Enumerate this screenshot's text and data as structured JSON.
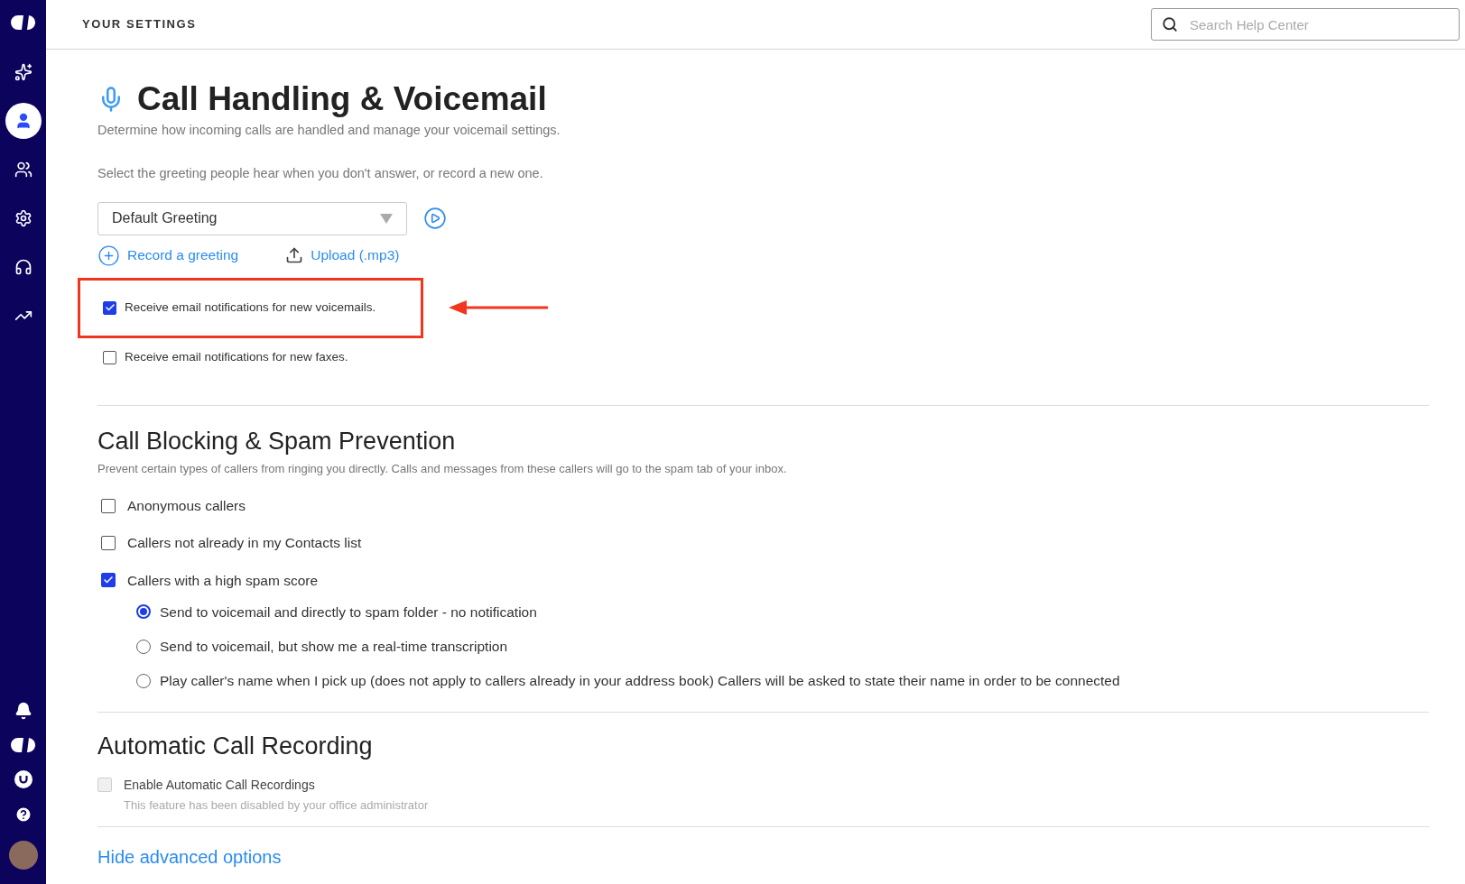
{
  "sidebar": {
    "items": [
      {
        "kind": "sparkle",
        "selected": false
      },
      {
        "kind": "person",
        "selected": true
      },
      {
        "kind": "team",
        "selected": false
      },
      {
        "kind": "gear",
        "selected": false
      },
      {
        "kind": "headset",
        "selected": false
      },
      {
        "kind": "trend",
        "selected": false
      }
    ],
    "bottom_items": [
      {
        "kind": "bell"
      },
      {
        "kind": "logo"
      },
      {
        "kind": "badge"
      },
      {
        "kind": "help"
      },
      {
        "kind": "avatar"
      }
    ]
  },
  "header": {
    "title": "YOUR SETTINGS",
    "search": {
      "placeholder": "Search Help Center"
    }
  },
  "voicemail": {
    "title": "Call Handling & Voicemail",
    "subtitle": "Determine how incoming calls are handled and manage your voicemail settings.",
    "prompt": "Select the greeting people hear when you don't answer, or record a new one.",
    "greeting_select": {
      "value": "Default Greeting"
    },
    "links": [
      {
        "kind": "record",
        "label": "Record a greeting"
      },
      {
        "kind": "upload",
        "label": "Upload (.mp3)"
      }
    ],
    "notifications": [
      {
        "label": "Receive email notifications for new voicemails.",
        "checked": true,
        "highlighted": true
      },
      {
        "label": "Receive email notifications for new faxes.",
        "checked": false,
        "highlighted": false
      }
    ]
  },
  "blocking": {
    "title": "Call Blocking & Spam Prevention",
    "description": "Prevent certain types of callers from ringing you directly. Calls and messages from these callers will go to the spam tab of your inbox.",
    "options": [
      {
        "label": "Anonymous callers",
        "checked": false
      },
      {
        "label": "Callers not already in my Contacts list",
        "checked": false
      },
      {
        "label": "Callers with a high spam score",
        "checked": true
      }
    ],
    "spam_actions": [
      {
        "label": "Send to voicemail and directly to spam folder - no notification",
        "selected": true
      },
      {
        "label": "Send to voicemail, but show me a real-time transcription",
        "selected": false
      },
      {
        "label": "Play caller's name when I pick up (does not apply to callers already in your address book) Callers will be asked to state their name in order to be connected",
        "selected": false
      }
    ]
  },
  "recording": {
    "title": "Automatic Call Recording",
    "option": {
      "label": "Enable Automatic Call Recordings",
      "checked": false,
      "disabled": true,
      "note": "This feature has been disabled by your office administrator"
    }
  },
  "advanced_link": "Hide advanced options"
}
